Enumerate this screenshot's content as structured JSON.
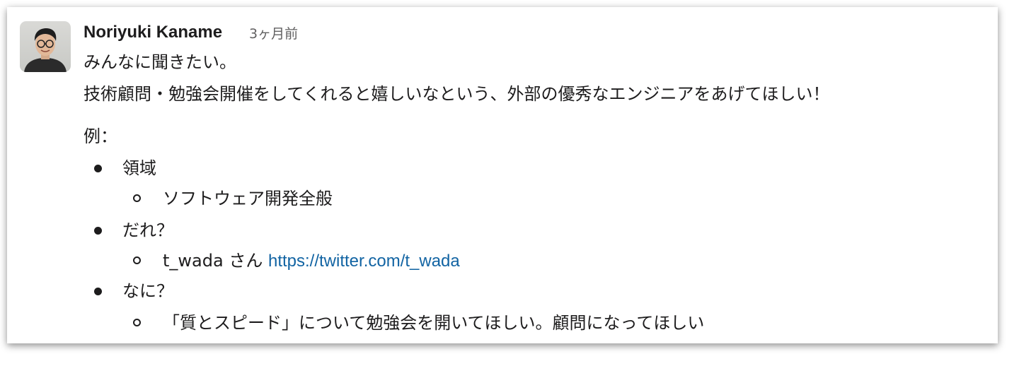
{
  "message": {
    "author": "Noriyuki Kaname",
    "timestamp": "3ヶ月前",
    "line1": "みんなに聞きたい。",
    "line2": "技術顧問・勉強会開催をしてくれると嬉しいなという、外部の優秀なエンジニアをあげてほしい！",
    "example_label": "例：",
    "list": [
      {
        "label": "領域",
        "sub": "ソフトウェア開発全般"
      },
      {
        "label": "だれ？",
        "sub_name": "t_wada さん",
        "sub_link": "https://twitter.com/t_wada"
      },
      {
        "label": "なに？",
        "sub": "「質とスピード」について勉強会を開いてほしい。顧問になってほしい"
      }
    ]
  },
  "colors": {
    "text": "#1d1c1d",
    "timestamp": "#616061",
    "link": "#1264a3"
  },
  "avatar_icon": "person-photo-avatar"
}
